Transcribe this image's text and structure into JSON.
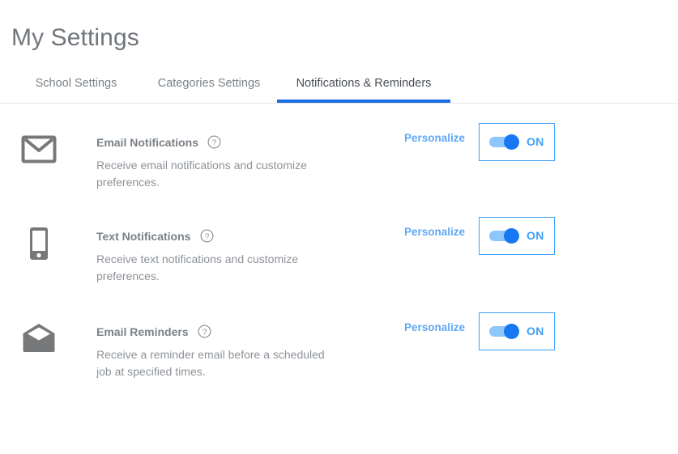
{
  "page": {
    "title": "My Settings"
  },
  "tabs": {
    "items": [
      {
        "label": "School Settings",
        "active": false
      },
      {
        "label": "Categories Settings",
        "active": false
      },
      {
        "label": "Notifications & Reminders",
        "active": true
      }
    ],
    "active_color": "#1b6ee0",
    "inactive_color": "#7b8188"
  },
  "settings": {
    "rows": [
      {
        "icon": "envelope-closed-icon",
        "title": "Email Notifications",
        "help": "?",
        "description": "Receive email notifications and customize preferences.",
        "personalize_label": "Personalize",
        "toggle_label": "ON",
        "toggle_state": "on"
      },
      {
        "icon": "mobile-phone-icon",
        "title": "Text Notifications",
        "help": "?",
        "description": "Receive text notifications and customize preferences.",
        "personalize_label": "Personalize",
        "toggle_label": "ON",
        "toggle_state": "on"
      },
      {
        "icon": "envelope-open-icon",
        "title": "Email Reminders",
        "help": "?",
        "description": "Receive a reminder email before a scheduled job at specified times.",
        "personalize_label": "Personalize",
        "toggle_label": "ON",
        "toggle_state": "on"
      }
    ]
  },
  "colors": {
    "accent_blue": "#1b6ee0",
    "toggle_blue": "#1877f2",
    "toggle_track": "#8dc6fb",
    "link_blue": "#5fa7f5",
    "text_gray": "#7a8086",
    "icon_gray": "#77787a"
  }
}
